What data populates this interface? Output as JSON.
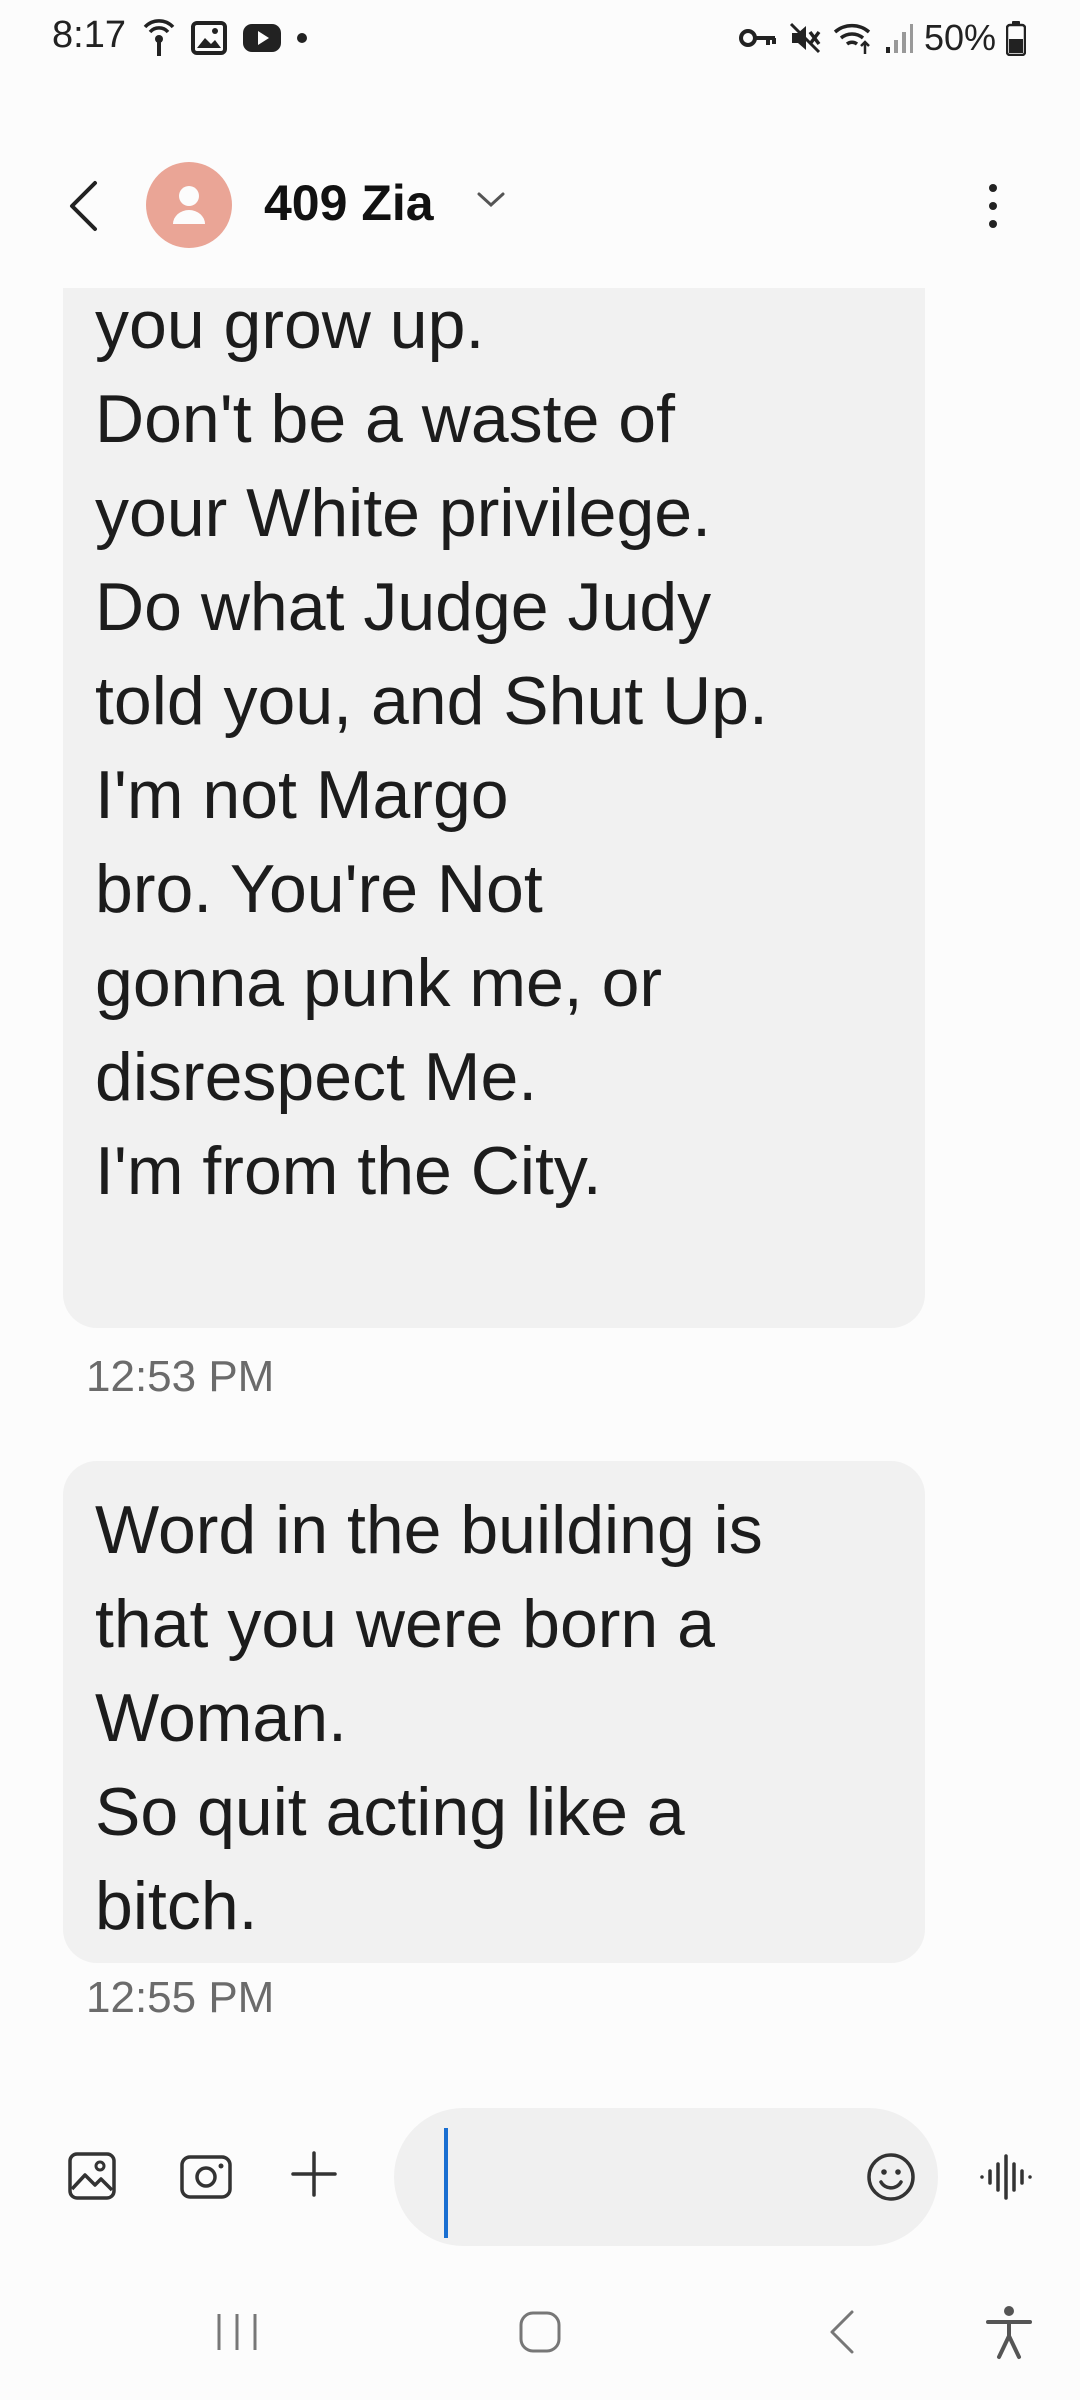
{
  "status_bar": {
    "time": "8:17",
    "battery": "50%",
    "icons_left": [
      "hotspot-icon",
      "image-notification-icon",
      "youtube-icon",
      "dot-icon"
    ],
    "icons_right": [
      "vpn-key-icon",
      "mute-icon",
      "wifi-icon",
      "signal-icon",
      "battery-icon"
    ]
  },
  "header": {
    "contact_name": "409 Zia",
    "avatar_color": "#eaa596"
  },
  "messages": [
    {
      "text": "you grow up.\nDon't be a waste of\nyour White privilege.\nDo what Judge Judy\ntold you, and  Shut Up.\nI'm not Margo\nbro. You're Not\ngonna punk me, or\ndisrespect Me.\nI'm from the City.",
      "time": "12:53 PM"
    },
    {
      "text": "Word in the building is\nthat you were born a\nWoman.\nSo quit acting like a\nbitch.",
      "time": "12:55 PM"
    }
  ],
  "composer": {
    "input_value": "",
    "placeholder": "",
    "accent_color": "#1a6fd1"
  },
  "nav_bar": {
    "buttons": [
      "recents-icon",
      "home-icon",
      "back-icon",
      "accessibility-icon"
    ]
  }
}
